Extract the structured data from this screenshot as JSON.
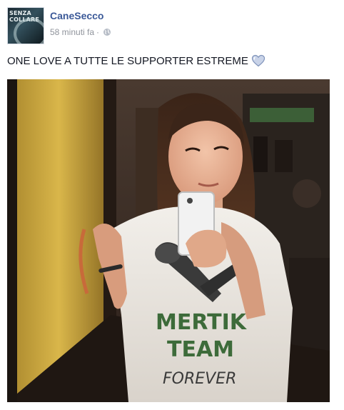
{
  "post": {
    "author": "CaneSecco",
    "avatar_text": "SENZA COLLARE",
    "timestamp": "58 minuti fa",
    "separator": "·",
    "privacy_icon": "globe-icon",
    "caption": "ONE LOVE A TUTTE LE SUPPORTER ESTREME",
    "emoji_icon": "heart-icon",
    "photo": {
      "shirt_text_line1": "MERTIK",
      "shirt_text_line2": "TEAM",
      "shirt_text_line3": "FOREVER"
    }
  },
  "colors": {
    "author_link": "#3b5998",
    "meta_gray": "#90949c",
    "heart_fill": "#c9d3e8"
  }
}
